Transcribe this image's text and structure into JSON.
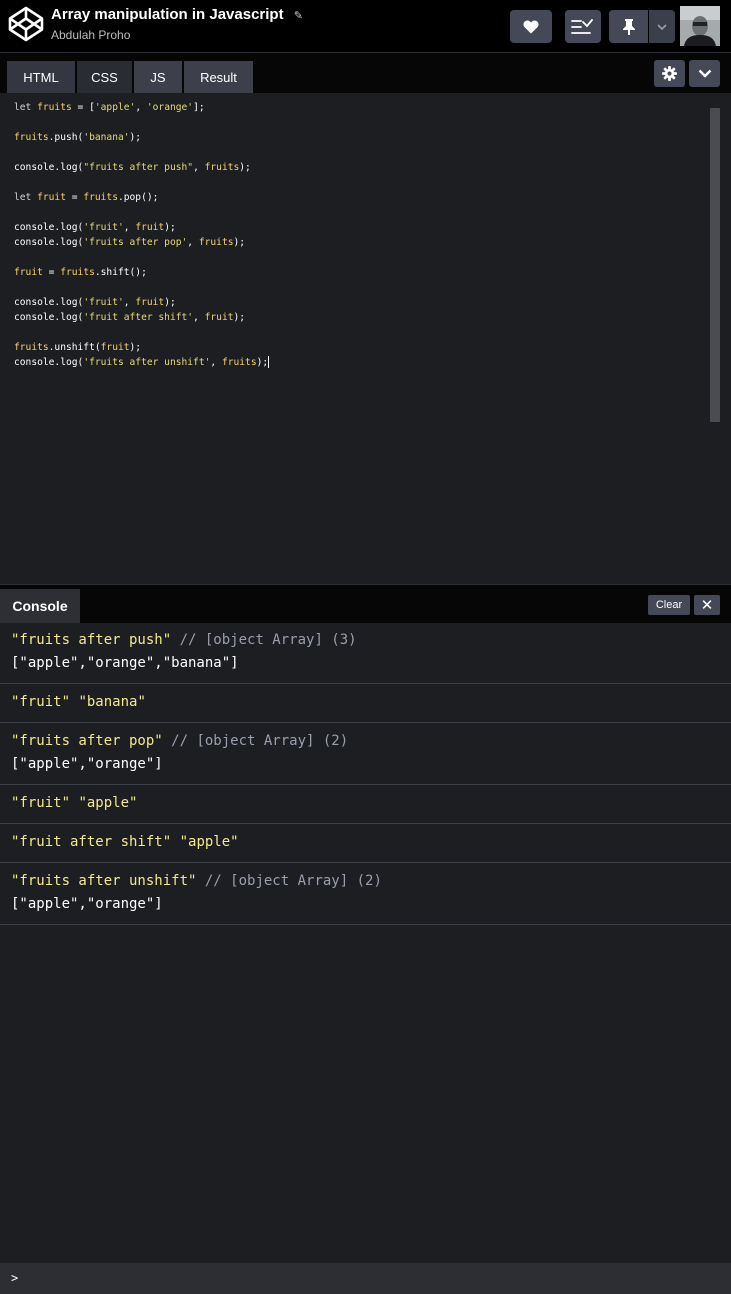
{
  "header": {
    "title": "Array manipulation in Javascript",
    "author": "Abdulah Proho"
  },
  "tabs": [
    {
      "label": "HTML"
    },
    {
      "label": "CSS"
    },
    {
      "label": "JS"
    },
    {
      "label": "Result"
    }
  ],
  "editor": {
    "language": "JS",
    "lines": [
      "let fruits = ['apple', 'orange'];",
      "",
      "fruits.push('banana');",
      "",
      "console.log(\"fruits after push\", fruits);",
      "",
      "let fruit = fruits.pop();",
      "",
      "console.log('fruit', fruit);",
      "console.log('fruits after pop', fruits);",
      "",
      "fruit = fruits.shift();",
      "",
      "console.log('fruit', fruit);",
      "console.log('fruit after shift', fruit);",
      "",
      "fruits.unshift(fruit);",
      "console.log('fruits after unshift', fruits);"
    ]
  },
  "console": {
    "tab_label": "Console",
    "clear_label": "Clear",
    "close_label": "✕",
    "prompt": ">",
    "entries": [
      {
        "label": "\"fruits after push\"",
        "comment": "// [object Array] (3)",
        "value": "[\"apple\",\"orange\",\"banana\"]"
      },
      {
        "label": "\"fruit\"",
        "plain": "\"banana\""
      },
      {
        "label": "\"fruits after pop\"",
        "comment": "// [object Array] (2)",
        "value": "[\"apple\",\"orange\"]"
      },
      {
        "label": "\"fruit\"",
        "plain": "\"apple\""
      },
      {
        "label": "\"fruit after shift\"",
        "plain": "\"apple\""
      },
      {
        "label": "\"fruits after unshift\"",
        "comment": "// [object Array] (2)",
        "value": "[\"apple\",\"orange\"]"
      }
    ]
  },
  "icons": {
    "logo": "codepen-logo-icon",
    "heart": "heart-icon",
    "layout": "layout-icon",
    "pin": "pin-icon",
    "dropdown": "chevron-down-icon",
    "settings": "gear-icon",
    "collapse": "chevron-down-icon",
    "edit": "pencil-icon"
  },
  "colors": {
    "background": "#1d1e22",
    "header": "#000000",
    "button": "#444857",
    "string": "#f3e98d",
    "comment": "#999fae"
  }
}
